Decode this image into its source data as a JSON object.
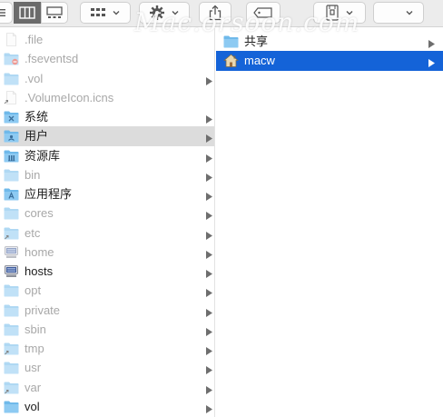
{
  "watermark": "Mac.orsoon.com",
  "toolbar": {
    "buttons": [
      "list-view",
      "column-view",
      "gallery-view",
      "group-menu",
      "action-menu",
      "share",
      "tag",
      "encrypt-menu",
      "extra-menu"
    ]
  },
  "column1": {
    "items": [
      {
        "label": ".file",
        "icon": "document-icon",
        "dim": true,
        "arrow": false
      },
      {
        "label": ".fseventsd",
        "icon": "restricted-folder-icon",
        "dim": true,
        "arrow": false
      },
      {
        "label": ".vol",
        "icon": "folder-icon",
        "dim": true,
        "arrow": true
      },
      {
        "label": ".VolumeIcon.icns",
        "icon": "alias-document-icon",
        "dim": true,
        "arrow": false
      },
      {
        "label": "系统",
        "icon": "system-folder-icon",
        "dim": false,
        "arrow": true
      },
      {
        "label": "用户",
        "icon": "users-folder-icon",
        "dim": false,
        "arrow": true,
        "selected": "gray"
      },
      {
        "label": "资源库",
        "icon": "library-folder-icon",
        "dim": false,
        "arrow": true
      },
      {
        "label": "bin",
        "icon": "folder-icon",
        "dim": true,
        "arrow": true
      },
      {
        "label": "应用程序",
        "icon": "applications-folder-icon",
        "dim": false,
        "arrow": true
      },
      {
        "label": "cores",
        "icon": "folder-icon",
        "dim": true,
        "arrow": true
      },
      {
        "label": "etc",
        "icon": "alias-folder-icon",
        "dim": true,
        "arrow": true
      },
      {
        "label": "home",
        "icon": "network-drive-icon",
        "dim": true,
        "arrow": true
      },
      {
        "label": "hosts",
        "icon": "network-drive-icon",
        "dim": false,
        "arrow": true
      },
      {
        "label": "opt",
        "icon": "folder-icon",
        "dim": true,
        "arrow": true
      },
      {
        "label": "private",
        "icon": "folder-icon",
        "dim": true,
        "arrow": true
      },
      {
        "label": "sbin",
        "icon": "folder-icon",
        "dim": true,
        "arrow": true
      },
      {
        "label": "tmp",
        "icon": "alias-folder-icon",
        "dim": true,
        "arrow": true
      },
      {
        "label": "usr",
        "icon": "folder-icon",
        "dim": true,
        "arrow": true
      },
      {
        "label": "var",
        "icon": "alias-folder-icon",
        "dim": true,
        "arrow": true
      },
      {
        "label": "vol",
        "icon": "folder-icon",
        "dim": false,
        "arrow": true
      }
    ]
  },
  "column2": {
    "items": [
      {
        "label": "共享",
        "icon": "folder-icon",
        "arrow": true
      },
      {
        "label": "macw",
        "icon": "home-icon",
        "arrow": true,
        "selected": "blue"
      }
    ]
  },
  "colors": {
    "selection_blue": "#1463d8",
    "selection_gray": "#dcdcdc",
    "folder_blue": "#6fb9ea",
    "dim_text": "#a8a8a8"
  }
}
